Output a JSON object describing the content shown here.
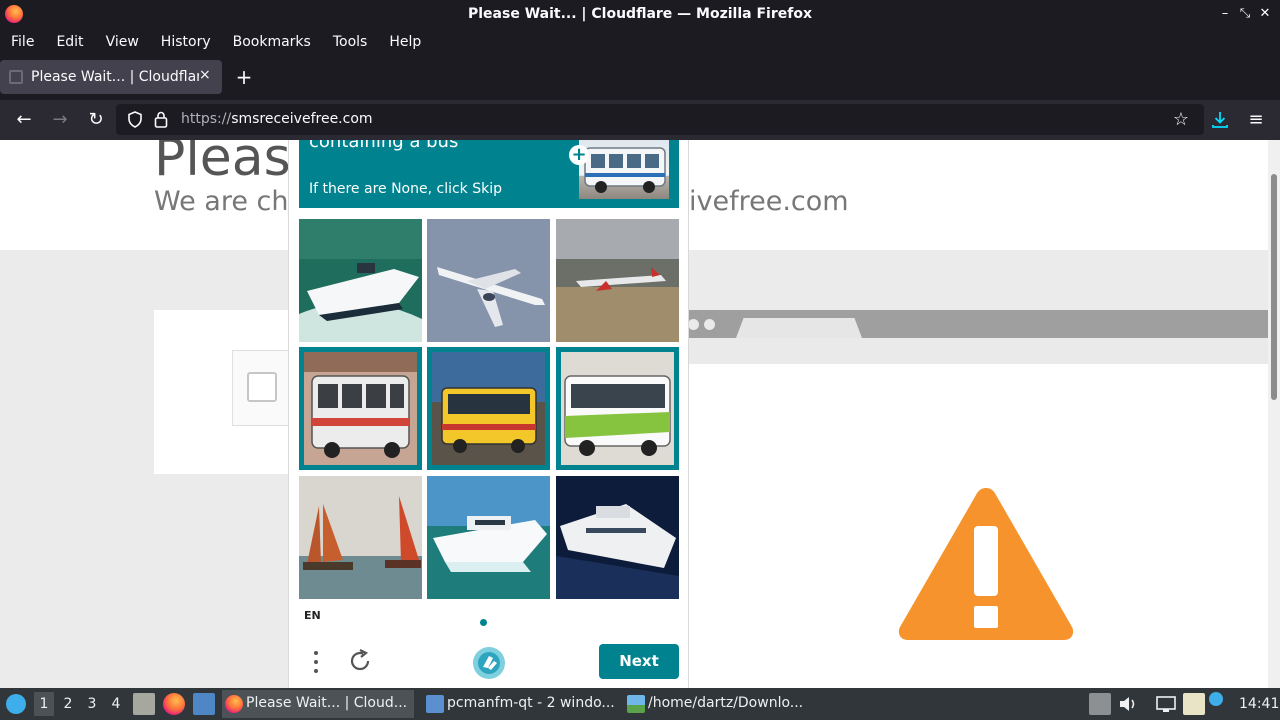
{
  "window": {
    "title": "Please Wait... | Cloudflare — Mozilla Firefox",
    "controls": [
      "minimize-icon",
      "maximize-icon",
      "close-icon"
    ]
  },
  "menubar": {
    "items": [
      "File",
      "Edit",
      "View",
      "History",
      "Bookmarks",
      "Tools",
      "Help"
    ]
  },
  "tabs": [
    {
      "title": "Please Wait... | Cloudflare",
      "close": "×"
    }
  ],
  "newtab_label": "+",
  "navbar": {
    "back": "←",
    "forward": "→",
    "reload": "↻",
    "url_protocol": "https://",
    "url_host": "smsreceivefree.com",
    "bookmark_star": "☆",
    "menu": "≡"
  },
  "page": {
    "title_partial": "Pleas",
    "subtitle_left": "We are ch",
    "subtitle_right": "ivefree.com"
  },
  "captcha": {
    "prompt_line1": "containing a bus",
    "prompt_line2": "If there are None, click Skip",
    "plus": "+",
    "language": "EN",
    "next_label": "Next",
    "accent_color": "#00838f",
    "tiles": [
      {
        "subject": "speedboat",
        "selected": false
      },
      {
        "subject": "airplane",
        "selected": false
      },
      {
        "subject": "airplane",
        "selected": false
      },
      {
        "subject": "bus",
        "selected": true
      },
      {
        "subject": "bus",
        "selected": true
      },
      {
        "subject": "bus",
        "selected": true
      },
      {
        "subject": "sailboats",
        "selected": false
      },
      {
        "subject": "yacht",
        "selected": false
      },
      {
        "subject": "yacht",
        "selected": false
      }
    ]
  },
  "taskbar": {
    "workspaces": [
      "1",
      "2",
      "3",
      "4"
    ],
    "active_workspace": "1",
    "tasks": [
      {
        "title": "Please Wait... | Cloud...",
        "icon": "firefox-icon",
        "active": true
      },
      {
        "title": "pcmanfm-qt - 2 windo...",
        "icon": "folder-icon",
        "active": false
      },
      {
        "title": "/home/dartz/Downlo...",
        "icon": "image-viewer-icon",
        "active": false
      }
    ],
    "clock": "14:41"
  }
}
